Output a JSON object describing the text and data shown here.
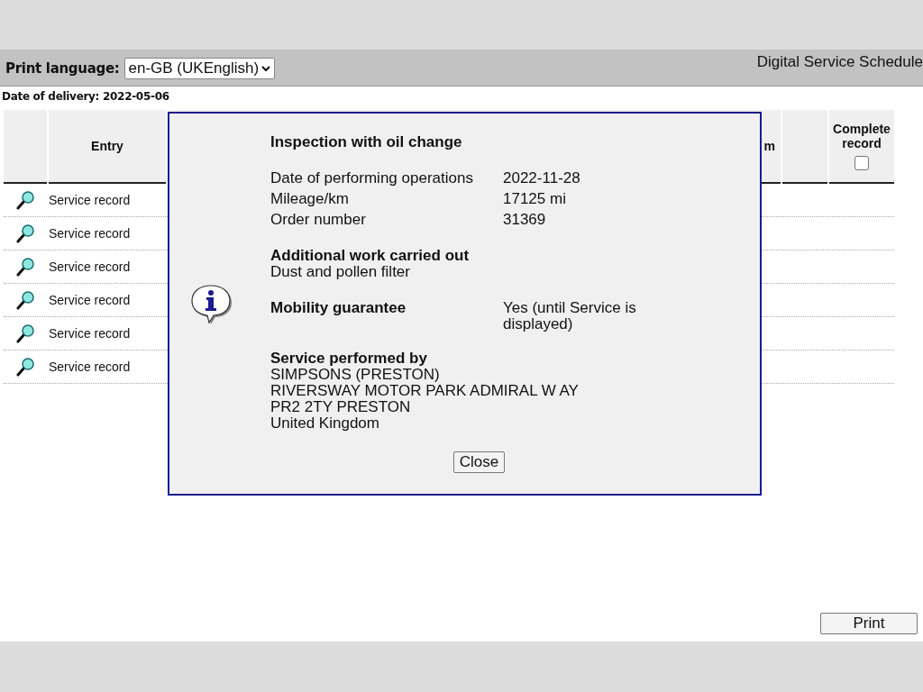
{
  "header": {
    "print_language_label": "Print language:",
    "print_language": "en-GB (UKEnglish)",
    "title": "Digital Service Schedule"
  },
  "delivery_date": "Date of delivery: 2022-05-06",
  "table": {
    "columns": [
      {
        "label": "Entry"
      },
      {
        "label": "m"
      },
      {
        "label": "Complete record",
        "checked": false
      }
    ],
    "rows": [
      {
        "entry": "Service record"
      },
      {
        "entry": "Service record"
      },
      {
        "entry": "Service record"
      },
      {
        "entry": "Service record"
      },
      {
        "entry": "Service record"
      },
      {
        "entry": "Service record"
      }
    ]
  },
  "dialog": {
    "title": "Inspection with oil change",
    "fields": [
      {
        "label": "Date of performing operations",
        "value": "2022-11-28"
      },
      {
        "label": "Mileage/km",
        "value": "17125 mi"
      },
      {
        "label": "Order number",
        "value": "31369"
      }
    ],
    "additional_work": {
      "heading": "Additional work carried out",
      "text": "Dust and pollen filter"
    },
    "mobility": {
      "label": "Mobility guarantee",
      "value": "Yes (until Service is displayed)"
    },
    "service_by": {
      "heading": "Service performed by",
      "lines": [
        "SIMPSONS (PRESTON)",
        "RIVERSWAY MOTOR PARK ADMIRAL W AY",
        "PR2 2TY PRESTON",
        "United Kingdom"
      ]
    },
    "close": "Close"
  },
  "print_button": "Print"
}
